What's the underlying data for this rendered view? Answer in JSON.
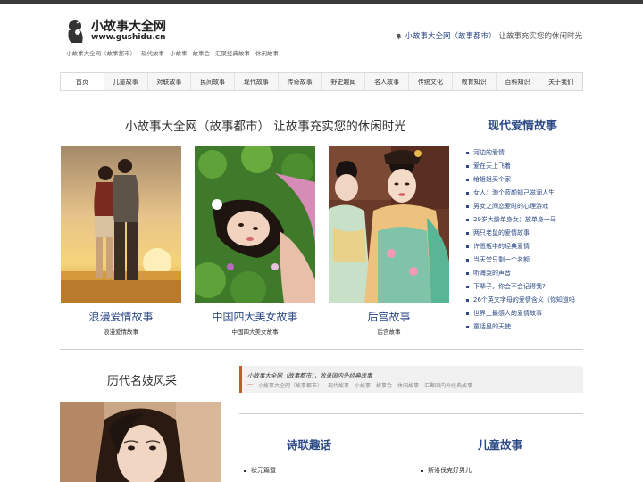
{
  "header": {
    "logo_title": "小故事大全网",
    "logo_url": "www.gushidu.cn",
    "top_links": [
      "小故事大全网（故事都市）",
      "现代故事",
      "小故事",
      "故事会",
      "汇聚经典故事",
      "休闲故事"
    ],
    "tagline_site": "小故事大全网（故事都市）",
    "tagline_text": "让故事充实您的休闲时光"
  },
  "nav": {
    "items": [
      "首页",
      "儿童故事",
      "对联故事",
      "民间故事",
      "现代故事",
      "传奇故事",
      "野史趣闻",
      "名人故事",
      "传统文化",
      "教育知识",
      "百科知识",
      "关于我们"
    ]
  },
  "main": {
    "headline": "小故事大全网（故事都市） 让故事充实您的休闲时光",
    "cards": [
      {
        "title": "浪漫爱情故事",
        "sub": "浪漫爱情故事"
      },
      {
        "title": "中国四大美女故事",
        "sub": "中国四大美女故事"
      },
      {
        "title": "后宫故事",
        "sub": "后宫故事"
      }
    ]
  },
  "sidebar": {
    "title": "现代爱情故事",
    "items": [
      "河边的爱情",
      "爱在天上飞着",
      "给姐姐买个家",
      "女人：淘个蓝颜知己滋润人生",
      "男女之间恋爱时的心理游戏",
      "29岁大龄单身女：放单身一马",
      "两只老鼠的爱情故事",
      "许愿瓶中的经典爱情",
      "当天堂只剩一个名额",
      "听海哭的声音",
      "下辈子，你会不会记得我?",
      "26个英文字母的爱情含义（你知道吗",
      "世界上最感人的爱情故事",
      "童话里的天使"
    ]
  },
  "lower": {
    "left_heading": "历代名妓风采",
    "notice_line1": "小故事大全网（故事都市），收录国内外经典故事",
    "notice_links": [
      "小故事大全网（故事都市）",
      "现代故事",
      "小故事",
      "故事会",
      "休闲故事",
      "汇聚国内外经典故事"
    ],
    "section1_title": "诗联趣话",
    "section1_items": [
      "状元篇暨"
    ],
    "section2_title": "儿童故事",
    "section2_items": [
      "斯洛伐克好男儿"
    ]
  },
  "colors": {
    "accent": "#2c4a86",
    "highlight": "#c85a2a"
  }
}
